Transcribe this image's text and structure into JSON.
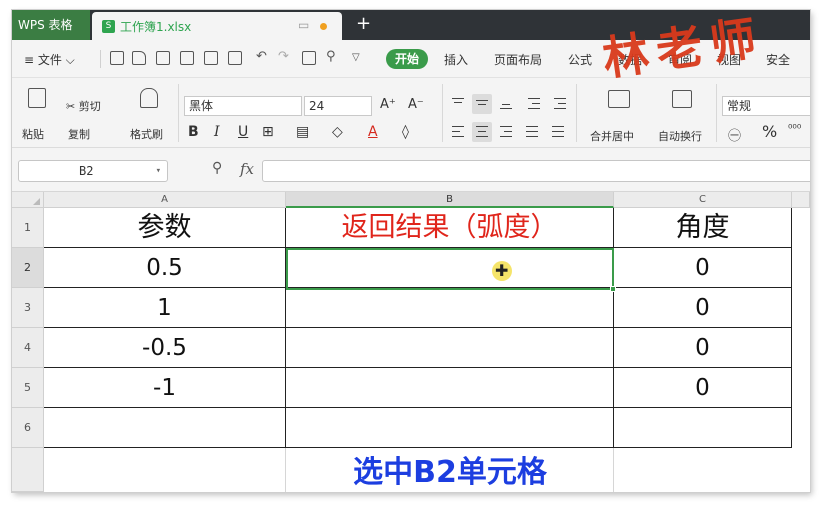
{
  "titlebar": {
    "app_name": "WPS 表格",
    "doc_name": "工作簿1.xlsx",
    "doc_icon": "S",
    "monitor_glyph": "▭",
    "new_tab": "+"
  },
  "menubar": {
    "file": "≡ 文件 ⌵",
    "start": "开始",
    "items": [
      "插入",
      "页面布局",
      "公式",
      "数据",
      "审阅",
      "视图",
      "安全"
    ]
  },
  "watermark": "林老师",
  "ribbon": {
    "paste": "粘贴",
    "cut": "✂ 剪切",
    "copy": "复制",
    "format_painter": "格式刷",
    "font_name": "黑体",
    "font_size": "24",
    "grow_font": "A⁺",
    "shrink_font": "A⁻",
    "bold": "B",
    "italic": "I",
    "underline": "U",
    "merge_center": "合并居中",
    "wrap_text": "自动换行",
    "number_format": "常规",
    "currency": "㊀",
    "percent": "%",
    "thousands": "⁰⁰⁰"
  },
  "formula": {
    "name_box": "B2",
    "fx": "fx",
    "content": ""
  },
  "sheet": {
    "columns": [
      "A",
      "B",
      "C"
    ],
    "rows": [
      "1",
      "2",
      "3",
      "4",
      "5",
      "6"
    ],
    "cells": [
      [
        "参数",
        "返回结果（弧度）",
        "角度"
      ],
      [
        "0.5",
        "",
        "0"
      ],
      [
        "1",
        "",
        "0"
      ],
      [
        "-0.5",
        "",
        "0"
      ],
      [
        "-1",
        "",
        "0"
      ],
      [
        "",
        "",
        ""
      ]
    ],
    "selected_cell": "B2"
  },
  "caption": "选中B2单元格",
  "colors": {
    "accent": "#3a9b4a",
    "header_red": "#e0251b",
    "caption_blue": "#1c3ee0",
    "watermark": "#d93a1c"
  }
}
